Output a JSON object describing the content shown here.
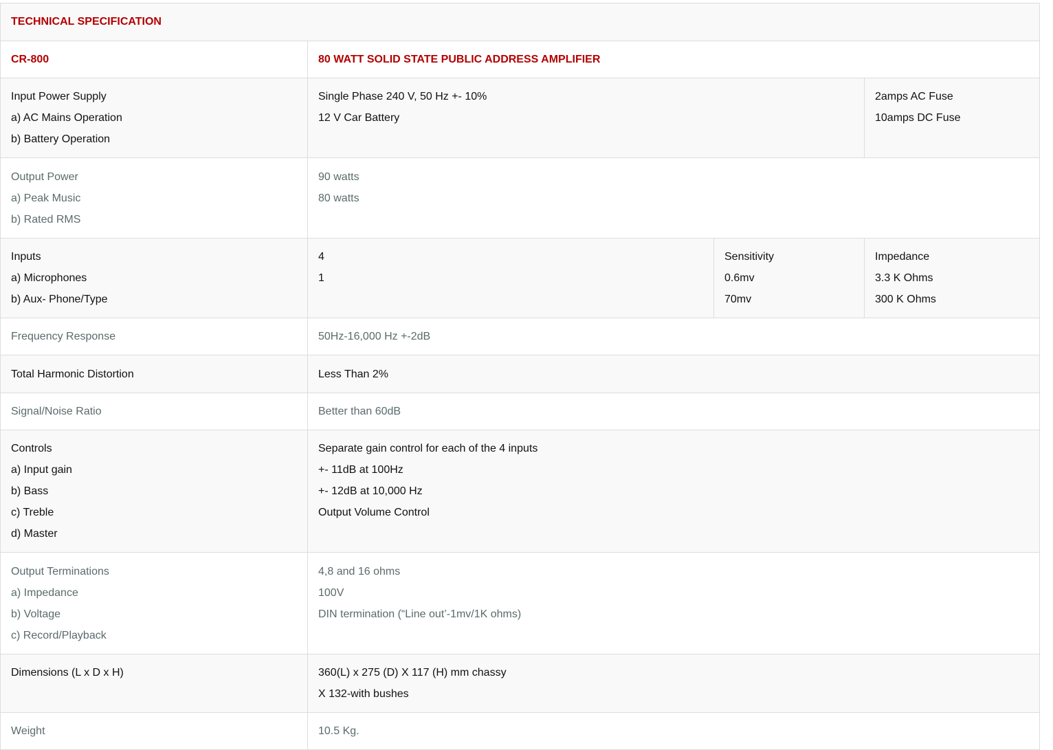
{
  "title": "TECHNICAL SPECIFICATION",
  "model": "CR-800",
  "model_desc": "80 WATT SOLID STATE PUBLIC ADDRESS AMPLIFIER",
  "input_power": {
    "labels": [
      "Input Power Supply",
      "a) AC Mains Operation",
      "b) Battery Operation"
    ],
    "values": [
      "Single Phase 240 V, 50 Hz +- 10%",
      "12 V Car Battery"
    ],
    "fuses": [
      "2amps AC Fuse",
      "10amps DC Fuse"
    ]
  },
  "output_power": {
    "labels": [
      "Output Power",
      "a) Peak Music",
      "b) Rated RMS"
    ],
    "values": [
      "90 watts",
      "80 watts"
    ]
  },
  "inputs": {
    "labels": [
      "Inputs",
      "a) Microphones",
      "b) Aux- Phone/Type"
    ],
    "counts": [
      "4",
      "1"
    ],
    "sensitivity": [
      "Sensitivity",
      "0.6mv",
      "70mv"
    ],
    "impedance": [
      "Impedance",
      "3.3 K Ohms",
      "300 K Ohms"
    ]
  },
  "frequency_response": {
    "label": "Frequency Response",
    "value": "50Hz-16,000 Hz +-2dB"
  },
  "thd": {
    "label": "Total Harmonic Distortion",
    "value": "Less Than 2%"
  },
  "snr": {
    "label": "Signal/Noise Ratio",
    "value": "Better than 60dB"
  },
  "controls": {
    "labels": [
      "Controls",
      "a) Input gain",
      "b) Bass",
      "c) Treble",
      "d) Master"
    ],
    "values": [
      "Separate gain control for each of the 4 inputs",
      "+- 11dB at 100Hz",
      "+- 12dB at 10,000 Hz",
      "Output Volume Control"
    ]
  },
  "output_terminations": {
    "labels": [
      "Output Terminations",
      "a) Impedance",
      "b) Voltage",
      "c) Record/Playback"
    ],
    "values": [
      "4,8 and 16 ohms",
      "100V",
      "DIN termination (“Line out’-1mv/1K ohms)"
    ]
  },
  "dimensions": {
    "label": "Dimensions (L x D x H)",
    "values": [
      "360(L) x 275 (D) X 117 (H) mm chassy",
      "X 132-with bushes"
    ]
  },
  "weight": {
    "label": "Weight",
    "value": "10.5 Kg."
  }
}
